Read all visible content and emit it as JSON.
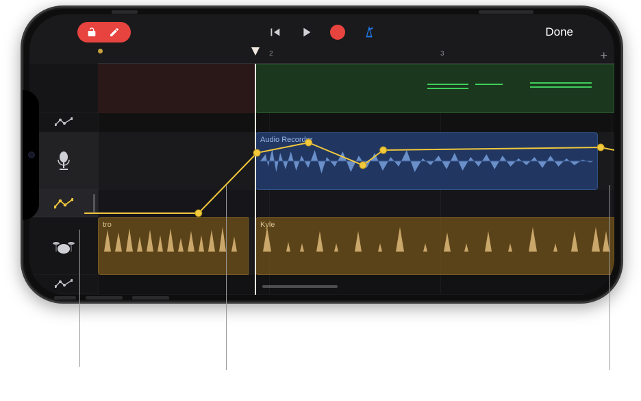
{
  "toolbar": {
    "done_label": "Done"
  },
  "ruler": {
    "ticks": [
      {
        "pos": 250,
        "label": "2"
      },
      {
        "pos": 500,
        "label": "3"
      }
    ],
    "add_label": "+"
  },
  "tracks": {
    "audio": {
      "region_label": "Audio Recorder"
    },
    "drummer": {
      "region1_label": "tro",
      "region2_label": "Kyle"
    }
  },
  "colors": {
    "automation": "#f2c83c",
    "record": "#e8443f",
    "metronome": "#1f7cf0"
  }
}
